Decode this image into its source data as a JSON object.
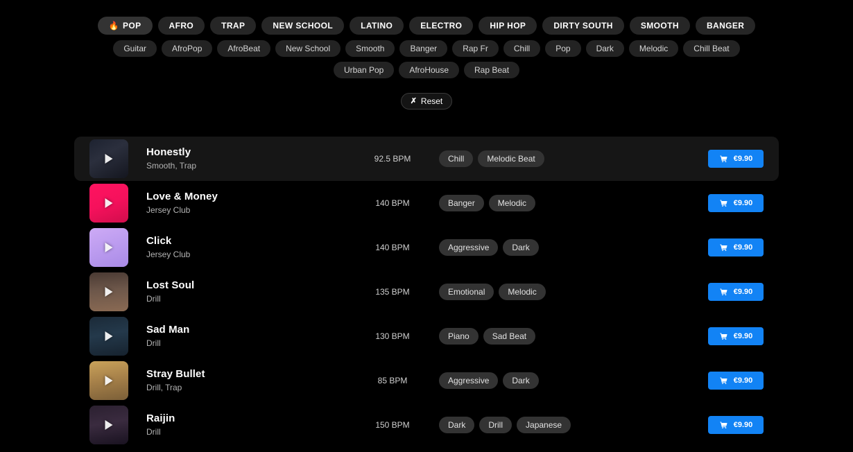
{
  "filters": {
    "genres": [
      {
        "label": "POP",
        "icon": "fire-icon",
        "selected": true
      },
      {
        "label": "AFRO",
        "selected": false
      },
      {
        "label": "TRAP",
        "selected": false
      },
      {
        "label": "NEW SCHOOL",
        "selected": false
      },
      {
        "label": "LATINO",
        "selected": false
      },
      {
        "label": "ELECTRO",
        "selected": false
      },
      {
        "label": "HIP HOP",
        "selected": false
      },
      {
        "label": "DIRTY SOUTH",
        "selected": false
      },
      {
        "label": "SMOOTH",
        "selected": false
      },
      {
        "label": "BANGER",
        "selected": false
      }
    ],
    "subtags": [
      {
        "label": "Guitar"
      },
      {
        "label": "AfroPop"
      },
      {
        "label": "AfroBeat"
      },
      {
        "label": "New School"
      },
      {
        "label": "Smooth"
      },
      {
        "label": "Banger"
      },
      {
        "label": "Rap Fr"
      },
      {
        "label": "Chill"
      },
      {
        "label": "Pop"
      },
      {
        "label": "Dark"
      },
      {
        "label": "Melodic"
      },
      {
        "label": "Chill Beat"
      },
      {
        "label": "Urban Pop"
      },
      {
        "label": "AfroHouse"
      },
      {
        "label": "Rap Beat"
      }
    ],
    "reset": {
      "label": "Reset",
      "icon": "x-icon"
    }
  },
  "accent_color": "#1283f5",
  "fire_color": "#f26522",
  "tracks": [
    {
      "title": "Honestly",
      "subtitle": "Smooth, Trap",
      "bpm": "92.5 BPM",
      "tags": [
        "Chill",
        "Melodic Beat"
      ],
      "price": "€9.90",
      "active": true,
      "art": "linear-gradient(150deg,#1d2230 0%,#2b2f3d 40%,#14161f 100%)"
    },
    {
      "title": "Love & Money",
      "subtitle": "Jersey Club",
      "bpm": "140 BPM",
      "tags": [
        "Banger",
        "Melodic"
      ],
      "price": "€9.90",
      "active": false,
      "art": "linear-gradient(160deg,#ff1360 0%,#f5115c 50%,#d10d4c 100%)"
    },
    {
      "title": "Click",
      "subtitle": "Jersey Club",
      "bpm": "140 BPM",
      "tags": [
        "Aggressive",
        "Dark"
      ],
      "price": "€9.90",
      "active": false,
      "art": "linear-gradient(160deg,#cdaaf5 0%,#bb9bef 50%,#a98ae6 100%)"
    },
    {
      "title": "Lost Soul",
      "subtitle": "Drill",
      "bpm": "135 BPM",
      "tags": [
        "Emotional",
        "Melodic"
      ],
      "price": "€9.90",
      "active": false,
      "art": "linear-gradient(175deg,#4a3a33 0%,#6d574a 45%,#8a6a53 100%)"
    },
    {
      "title": "Sad Man",
      "subtitle": "Drill",
      "bpm": "130 BPM",
      "tags": [
        "Piano",
        "Sad Beat"
      ],
      "price": "€9.90",
      "active": false,
      "art": "linear-gradient(170deg,#1b2a38 0%,#24394b 45%,#16222e 100%)"
    },
    {
      "title": "Stray Bullet",
      "subtitle": "Drill, Trap",
      "bpm": "85 BPM",
      "tags": [
        "Aggressive",
        "Dark"
      ],
      "price": "€9.90",
      "active": false,
      "art": "linear-gradient(170deg,#c9a25a 0%,#a8824a 45%,#7b5f38 100%)"
    },
    {
      "title": "Raijin",
      "subtitle": "Drill",
      "bpm": "150 BPM",
      "tags": [
        "Dark",
        "Drill",
        "Japanese"
      ],
      "price": "€9.90",
      "active": false,
      "art": "linear-gradient(170deg,#2b2030 0%,#3a2b3f 45%,#191220 100%)"
    }
  ]
}
